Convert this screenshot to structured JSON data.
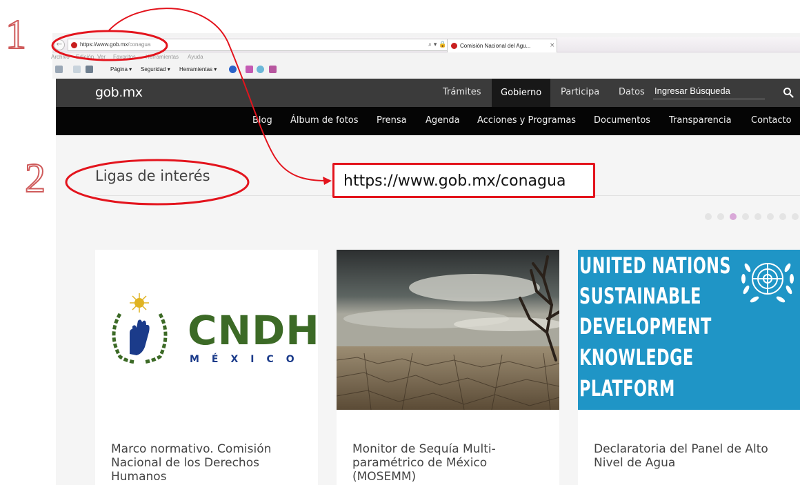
{
  "annotations": {
    "step1": "1",
    "step2": "2",
    "highlight_url": "https://www.gob.mx/conagua",
    "colors": {
      "ellipse": "#e3141d",
      "number_outline": "#cf5b5b"
    }
  },
  "browser": {
    "url_host": "https://www.gob.mx",
    "url_path": "/conagua",
    "url_tools": "⌕ ▾ 🔒 C",
    "tab_title": "Comisión Nacional del Agu...",
    "tab_close": "×",
    "menu": [
      "Archivo",
      "Edición",
      "Ver",
      "Favoritos",
      "Herramientas",
      "Ayuda"
    ],
    "commands": [
      "Página ▾",
      "Seguridad ▾",
      "Herramientas ▾"
    ]
  },
  "site": {
    "logo_main": "gob",
    "logo_dot": ".",
    "logo_suffix": "mx",
    "top_nav": [
      "Trámites",
      "Gobierno",
      "Participa",
      "Datos"
    ],
    "active_top": "Gobierno",
    "search_placeholder": "Ingresar Búsqueda",
    "sub_nav": [
      "Blog",
      "Álbum de fotos",
      "Prensa",
      "Agenda",
      "Acciones y Programas",
      "Documentos",
      "Transparencia",
      "Contacto"
    ],
    "colors": {
      "topbar": "#3b3b3b",
      "subnav": "#050505",
      "background": "#f5f5f5"
    }
  },
  "section": {
    "title": "Ligas de interés",
    "carousel": {
      "dot_count": 8,
      "active_index": 3
    }
  },
  "cards": [
    {
      "title": "Marco normativo. Comisión Nacional de los Derechos Humanos",
      "logo_main": "CNDH",
      "logo_sub": "MÉXICO"
    },
    {
      "title": "Monitor de Sequía Multi-paramétrico de México (MOSEMM)"
    },
    {
      "title": "Declaratoria del Panel de Alto Nivel de Agua",
      "banner_lines": [
        "UNITED NATIONS",
        "SUSTAINABLE",
        "DEVELOPMENT",
        "KNOWLEDGE",
        "PLATFORM"
      ]
    }
  ]
}
